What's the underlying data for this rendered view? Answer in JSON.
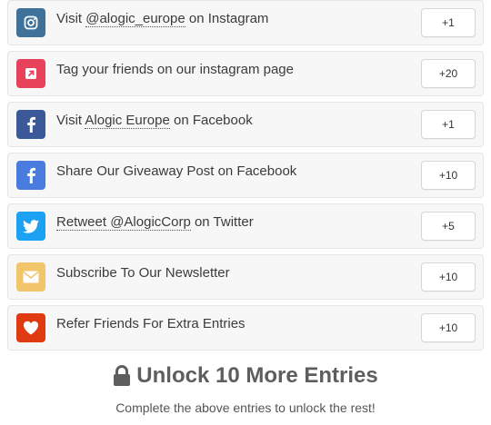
{
  "entries": [
    {
      "prefix": "Visit ",
      "link": "@alogic_europe",
      "suffix": " on Instagram",
      "points": "+1",
      "icon": "instagram-icon",
      "color": "#3f729b"
    },
    {
      "prefix": "Tag your friends on our instagram page",
      "link": "",
      "suffix": "",
      "points": "+20",
      "icon": "external-link-icon",
      "color": "#e8415b"
    },
    {
      "prefix": "Visit ",
      "link": "Alogic Europe",
      "suffix": " on Facebook",
      "points": "+1",
      "icon": "facebook-icon",
      "color": "#3b5998"
    },
    {
      "prefix": "Share Our Giveaway Post on Facebook",
      "link": "",
      "suffix": "",
      "points": "+10",
      "icon": "facebook-icon",
      "color": "#4a7ce0"
    },
    {
      "prefix": "",
      "link": "Retweet @AlogicCorp",
      "suffix": " on Twitter",
      "points": "+5",
      "icon": "twitter-icon",
      "color": "#1da1f2"
    },
    {
      "prefix": "Subscribe To Our Newsletter",
      "link": "",
      "suffix": "",
      "points": "+10",
      "icon": "envelope-icon",
      "color": "#f2c56b"
    },
    {
      "prefix": "Refer Friends For Extra Entries",
      "link": "",
      "suffix": "",
      "points": "+10",
      "icon": "heart-icon",
      "color": "#e03a12"
    }
  ],
  "unlock": {
    "title": "Unlock 10 More Entries",
    "subtitle": "Complete the above entries to unlock the rest!",
    "icon": "lock-icon"
  }
}
